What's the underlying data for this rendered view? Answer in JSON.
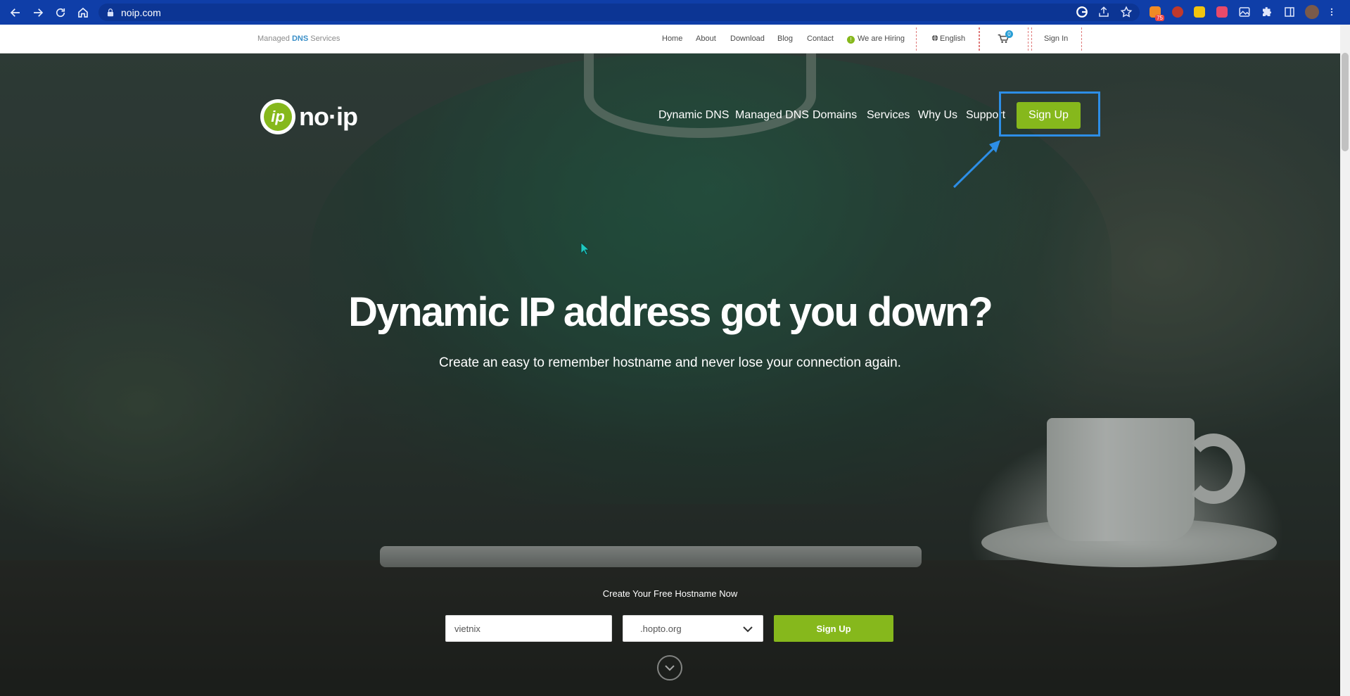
{
  "browser": {
    "url": "noip.com",
    "nav_icons": [
      "back-icon",
      "forward-icon",
      "reload-icon",
      "home-icon"
    ],
    "extension_icons": [
      "google-icon",
      "share-icon",
      "bookmark-star-icon",
      "extension-badge-icon",
      "extension-icon",
      "extension-icon",
      "extension-icon",
      "image-icon",
      "puzzle-icon",
      "sidebar-icon",
      "profile-avatar",
      "menu-kebab-icon"
    ],
    "extension_badge": "75"
  },
  "topbar": {
    "tagline_prefix": "Managed ",
    "tagline_bold": "DNS",
    "tagline_suffix": " Services",
    "links": {
      "home": "Home",
      "about": "About",
      "download": "Download",
      "blog": "Blog",
      "contact": "Contact",
      "hiring": "We are Hiring",
      "language": "English",
      "sign_in": "Sign In"
    },
    "cart_count": "0"
  },
  "header": {
    "logo_mark": "ip",
    "logo_text": "no·ip",
    "nav": {
      "dynamic_dns": "Dynamic DNS",
      "managed_dns": "Managed DNS",
      "domains": "Domains",
      "services": "Services",
      "why_us": "Why Us",
      "support": "Support"
    },
    "signup_label": "Sign Up"
  },
  "hero": {
    "headline": "Dynamic IP address got you down?",
    "subhead": "Create an easy to remember hostname and never lose your connection again."
  },
  "form": {
    "label": "Create Your Free Hostname Now",
    "hostname_value": "vietnix",
    "domain_selected": ".hopto.org",
    "submit_label": "Sign Up"
  },
  "colors": {
    "chrome_blue": "#0f3ea8",
    "brand_green": "#86b81c",
    "annotation_blue": "#2d8ee6",
    "dns_blue": "#3a8fc8"
  }
}
